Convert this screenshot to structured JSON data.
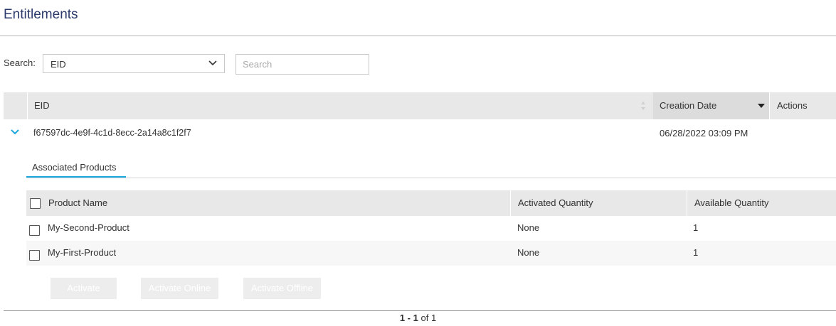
{
  "page": {
    "title": "Entitlements"
  },
  "search": {
    "label": "Search:",
    "field_selected": "EID",
    "placeholder": "Search"
  },
  "grid": {
    "columns": {
      "eid": "EID",
      "creation_date": "Creation Date",
      "actions": "Actions"
    },
    "rows": [
      {
        "eid": "f67597dc-4e9f-4c1d-8ecc-2a14a8c1f2f7",
        "creation_date": "06/28/2022 03:09 PM",
        "expanded": true
      }
    ]
  },
  "details": {
    "tab_label": "Associated Products",
    "columns": {
      "product_name": "Product Name",
      "activated_quantity": "Activated Quantity",
      "available_quantity": "Available Quantity"
    },
    "products": [
      {
        "name": "My-Second-Product",
        "activated": "None",
        "available": "1",
        "checked": false
      },
      {
        "name": "My-First-Product",
        "activated": "None",
        "available": "1",
        "checked": false
      }
    ],
    "buttons": {
      "activate": "Activate",
      "activate_online": "Activate Online",
      "activate_offline": "Activate Offline"
    }
  },
  "pager": {
    "range": "1 - 1",
    "of_label": "of",
    "total": "1"
  },
  "colors": {
    "accent": "#1ca8dd",
    "title": "#2b3a6b",
    "header_bg": "#e8e8e8"
  }
}
